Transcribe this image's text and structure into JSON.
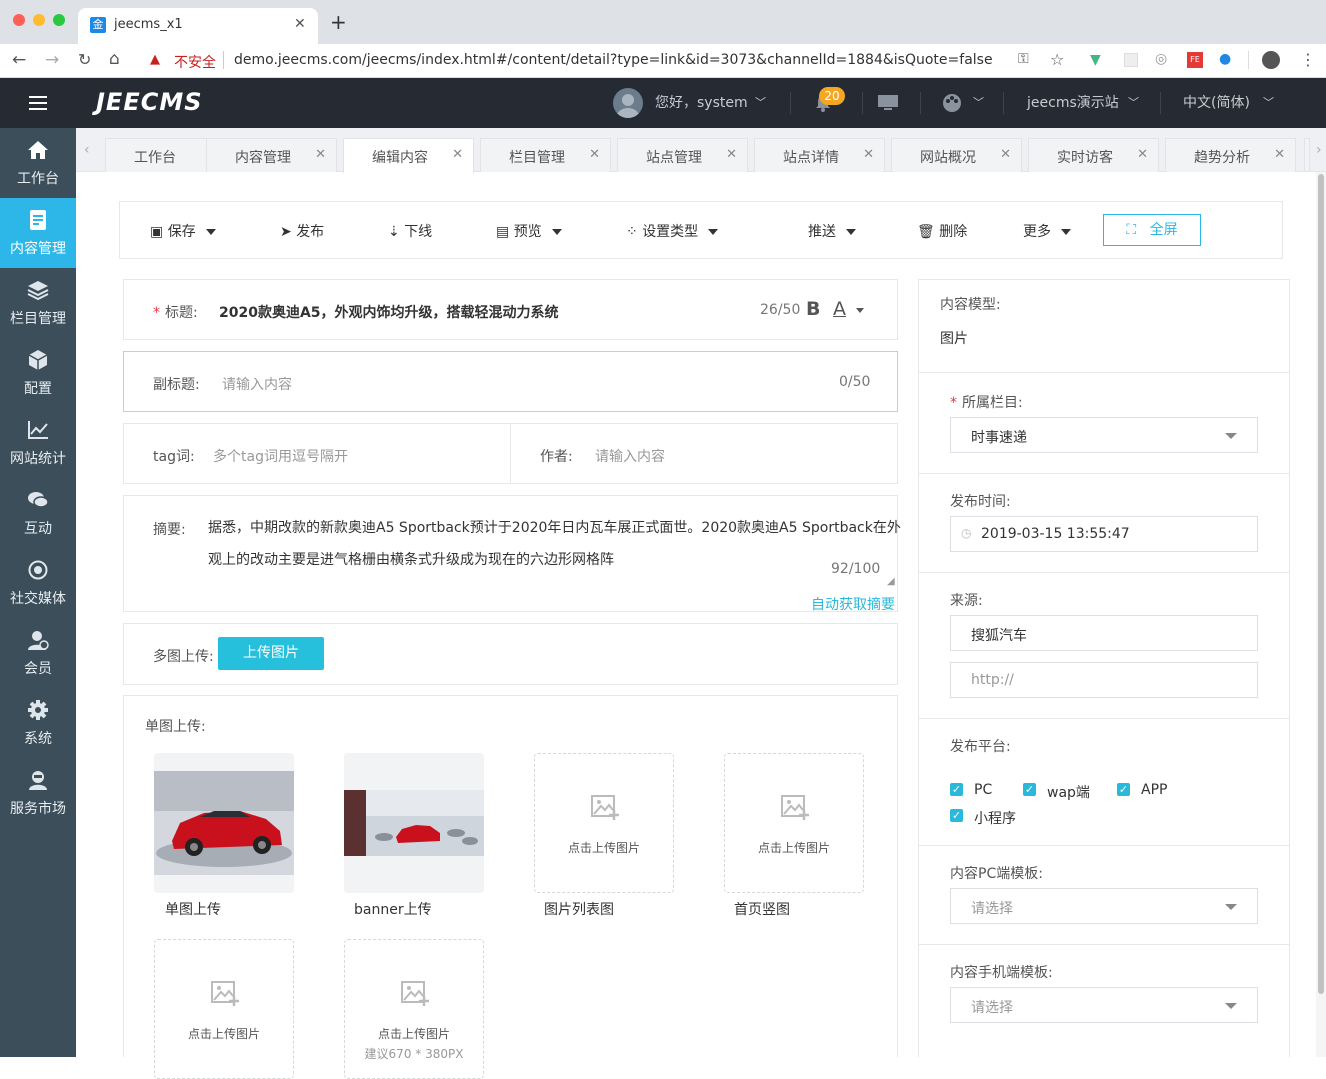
{
  "browser": {
    "tab_title": "jeecms_x1",
    "tab_favicon": "金",
    "insecure_label": "不安全",
    "url": "demo.jeecms.com/jeecms/index.html#/content/detail?type=link&id=3073&channelId=1884&isQuote=false"
  },
  "header": {
    "logo": "JEECMS",
    "greeting": "您好，system",
    "notification_count": "20",
    "site_name": "jeecms演示站",
    "language": "中文(简体)"
  },
  "sidebar": {
    "items": [
      {
        "label": "工作台",
        "icon": "home-icon"
      },
      {
        "label": "内容管理",
        "icon": "document-icon",
        "active": true
      },
      {
        "label": "栏目管理",
        "icon": "layers-icon"
      },
      {
        "label": "配置",
        "icon": "cube-icon"
      },
      {
        "label": "网站统计",
        "icon": "line-chart-icon"
      },
      {
        "label": "互动",
        "icon": "chat-icon"
      },
      {
        "label": "社交媒体",
        "icon": "target-icon"
      },
      {
        "label": "会员",
        "icon": "member-icon"
      },
      {
        "label": "系统",
        "icon": "gear-icon"
      },
      {
        "label": "服务市场",
        "icon": "service-icon"
      }
    ]
  },
  "tabs": [
    {
      "label": "工作台",
      "closable": false
    },
    {
      "label": "内容管理",
      "closable": true
    },
    {
      "label": "编辑内容",
      "closable": true,
      "active": true
    },
    {
      "label": "栏目管理",
      "closable": true
    },
    {
      "label": "站点管理",
      "closable": true
    },
    {
      "label": "站点详情",
      "closable": true
    },
    {
      "label": "网站概况",
      "closable": true
    },
    {
      "label": "实时访客",
      "closable": true
    },
    {
      "label": "趋势分析",
      "closable": true
    }
  ],
  "toolbar": {
    "save": "保存",
    "publish": "发布",
    "offline": "下线",
    "preview": "预览",
    "set_type": "设置类型",
    "push": "推送",
    "delete": "删除",
    "more": "更多",
    "fullscreen": "全屏"
  },
  "form": {
    "title_label": "标题:",
    "title_value": "2020款奥迪A5，外观内饰均升级，搭载轻混动力系统",
    "title_count": "26/50",
    "bold": "B",
    "font_color": "A",
    "subtitle_label": "副标题:",
    "subtitle_placeholder": "请输入内容",
    "subtitle_count": "0/50",
    "tag_label": "tag词:",
    "tag_placeholder": "多个tag词用逗号隔开",
    "author_label": "作者:",
    "author_placeholder": "请输入内容",
    "summary_label": "摘要:",
    "summary_line1": "据悉，中期改款的新款奥迪A5 Sportback预计于2020年日内瓦车展正式面世。2020款奥迪A5 Sportback在外",
    "summary_line2": "观上的改动主要是进气格栅由横条式升级成为现在的六边形网格阵",
    "summary_count": "92/100",
    "auto_summary": "自动获取摘要",
    "multi_upload_label": "多图上传:",
    "upload_button": "上传图片",
    "single_upload_label": "单图上传:",
    "images": [
      {
        "caption": "单图上传",
        "filled": true
      },
      {
        "caption": "banner上传",
        "filled": true
      },
      {
        "caption": "图片列表图",
        "placeholder": "点击上传图片"
      },
      {
        "caption": "首页竖图",
        "placeholder": "点击上传图片"
      },
      {
        "caption": "",
        "placeholder": "点击上传图片"
      },
      {
        "caption": "",
        "placeholder": "点击上传图片",
        "hint": "建议670 * 380PX"
      }
    ]
  },
  "right_panel": {
    "model_label": "内容模型:",
    "model_value": "图片",
    "channel_label": "所属栏目:",
    "channel_value": "时事速递",
    "publish_time_label": "发布时间:",
    "publish_time_value": "2019-03-15 13:55:47",
    "source_label": "来源:",
    "source_value": "搜狐汽车",
    "source_url_placeholder": "http://",
    "platform_label": "发布平台:",
    "platforms": [
      "PC",
      "wap端",
      "APP",
      "小程序"
    ],
    "pc_template_label": "内容PC端模板:",
    "pc_template_placeholder": "请选择",
    "mobile_template_label": "内容手机端模板:",
    "mobile_template_placeholder": "请选择"
  },
  "colors": {
    "accent": "#2cb7e8",
    "sidebar_bg": "#3c4e5a",
    "header_bg": "#262b33",
    "badge": "#f5a623",
    "required": "#e0393e"
  }
}
